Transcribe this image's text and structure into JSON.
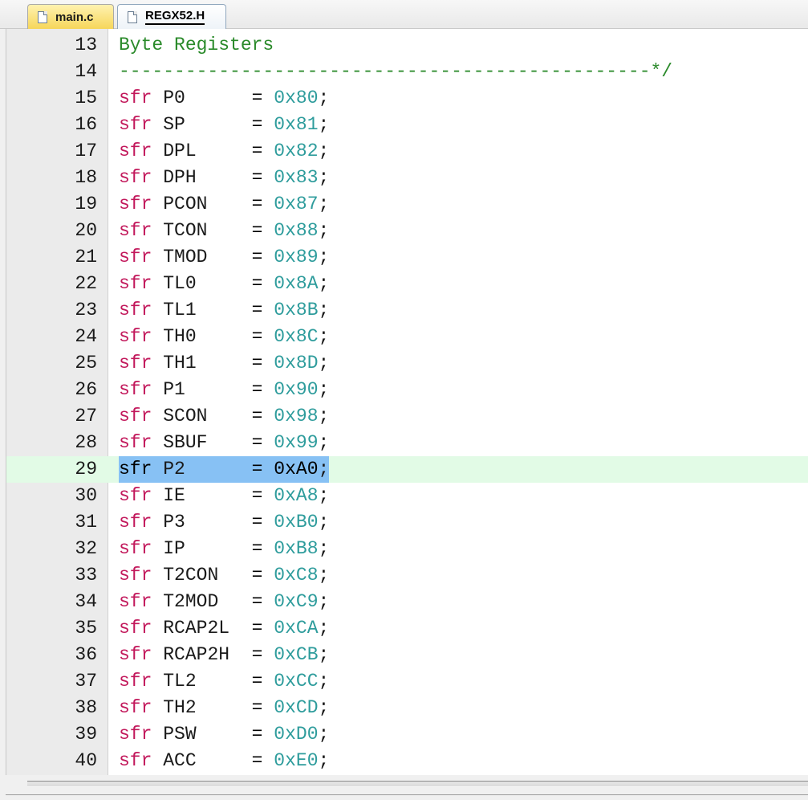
{
  "tabs": [
    {
      "label": "main.c",
      "active": false
    },
    {
      "label": "REGX52.H",
      "active": true
    }
  ],
  "editor": {
    "current_line": 29,
    "lines": [
      {
        "n": "13",
        "kind": "comment",
        "text": "Byte Registers"
      },
      {
        "n": "14",
        "kind": "comment",
        "text": "------------------------------------------------*/"
      },
      {
        "n": "15",
        "kind": "sfr",
        "kw": "sfr",
        "name": "P0    ",
        "hex": "0x80"
      },
      {
        "n": "16",
        "kind": "sfr",
        "kw": "sfr",
        "name": "SP    ",
        "hex": "0x81"
      },
      {
        "n": "17",
        "kind": "sfr",
        "kw": "sfr",
        "name": "DPL   ",
        "hex": "0x82"
      },
      {
        "n": "18",
        "kind": "sfr",
        "kw": "sfr",
        "name": "DPH   ",
        "hex": "0x83"
      },
      {
        "n": "19",
        "kind": "sfr",
        "kw": "sfr",
        "name": "PCON  ",
        "hex": "0x87"
      },
      {
        "n": "20",
        "kind": "sfr",
        "kw": "sfr",
        "name": "TCON  ",
        "hex": "0x88"
      },
      {
        "n": "21",
        "kind": "sfr",
        "kw": "sfr",
        "name": "TMOD  ",
        "hex": "0x89"
      },
      {
        "n": "22",
        "kind": "sfr",
        "kw": "sfr",
        "name": "TL0   ",
        "hex": "0x8A"
      },
      {
        "n": "23",
        "kind": "sfr",
        "kw": "sfr",
        "name": "TL1   ",
        "hex": "0x8B"
      },
      {
        "n": "24",
        "kind": "sfr",
        "kw": "sfr",
        "name": "TH0   ",
        "hex": "0x8C"
      },
      {
        "n": "25",
        "kind": "sfr",
        "kw": "sfr",
        "name": "TH1   ",
        "hex": "0x8D"
      },
      {
        "n": "26",
        "kind": "sfr",
        "kw": "sfr",
        "name": "P1    ",
        "hex": "0x90"
      },
      {
        "n": "27",
        "kind": "sfr",
        "kw": "sfr",
        "name": "SCON  ",
        "hex": "0x98"
      },
      {
        "n": "28",
        "kind": "sfr",
        "kw": "sfr",
        "name": "SBUF  ",
        "hex": "0x99"
      },
      {
        "n": "29",
        "kind": "sfr",
        "kw": "sfr",
        "name": "P2    ",
        "hex": "0xA0",
        "selected": true
      },
      {
        "n": "30",
        "kind": "sfr",
        "kw": "sfr",
        "name": "IE    ",
        "hex": "0xA8"
      },
      {
        "n": "31",
        "kind": "sfr",
        "kw": "sfr",
        "name": "P3    ",
        "hex": "0xB0"
      },
      {
        "n": "32",
        "kind": "sfr",
        "kw": "sfr",
        "name": "IP    ",
        "hex": "0xB8"
      },
      {
        "n": "33",
        "kind": "sfr",
        "kw": "sfr",
        "name": "T2CON ",
        "hex": "0xC8"
      },
      {
        "n": "34",
        "kind": "sfr",
        "kw": "sfr",
        "name": "T2MOD ",
        "hex": "0xC9"
      },
      {
        "n": "35",
        "kind": "sfr",
        "kw": "sfr",
        "name": "RCAP2L",
        "hex": "0xCA"
      },
      {
        "n": "36",
        "kind": "sfr",
        "kw": "sfr",
        "name": "RCAP2H",
        "hex": "0xCB"
      },
      {
        "n": "37",
        "kind": "sfr",
        "kw": "sfr",
        "name": "TL2   ",
        "hex": "0xCC"
      },
      {
        "n": "38",
        "kind": "sfr",
        "kw": "sfr",
        "name": "TH2   ",
        "hex": "0xCD"
      },
      {
        "n": "39",
        "kind": "sfr",
        "kw": "sfr",
        "name": "PSW   ",
        "hex": "0xD0"
      },
      {
        "n": "40",
        "kind": "sfr",
        "kw": "sfr",
        "name": "ACC   ",
        "hex": "0xE0"
      }
    ]
  },
  "colors": {
    "keyword": "#c2185b",
    "hex": "#2e9c9c",
    "comment": "#2a8a2a",
    "selection": "#87c1f4",
    "current_line": "#e2fbe6"
  }
}
